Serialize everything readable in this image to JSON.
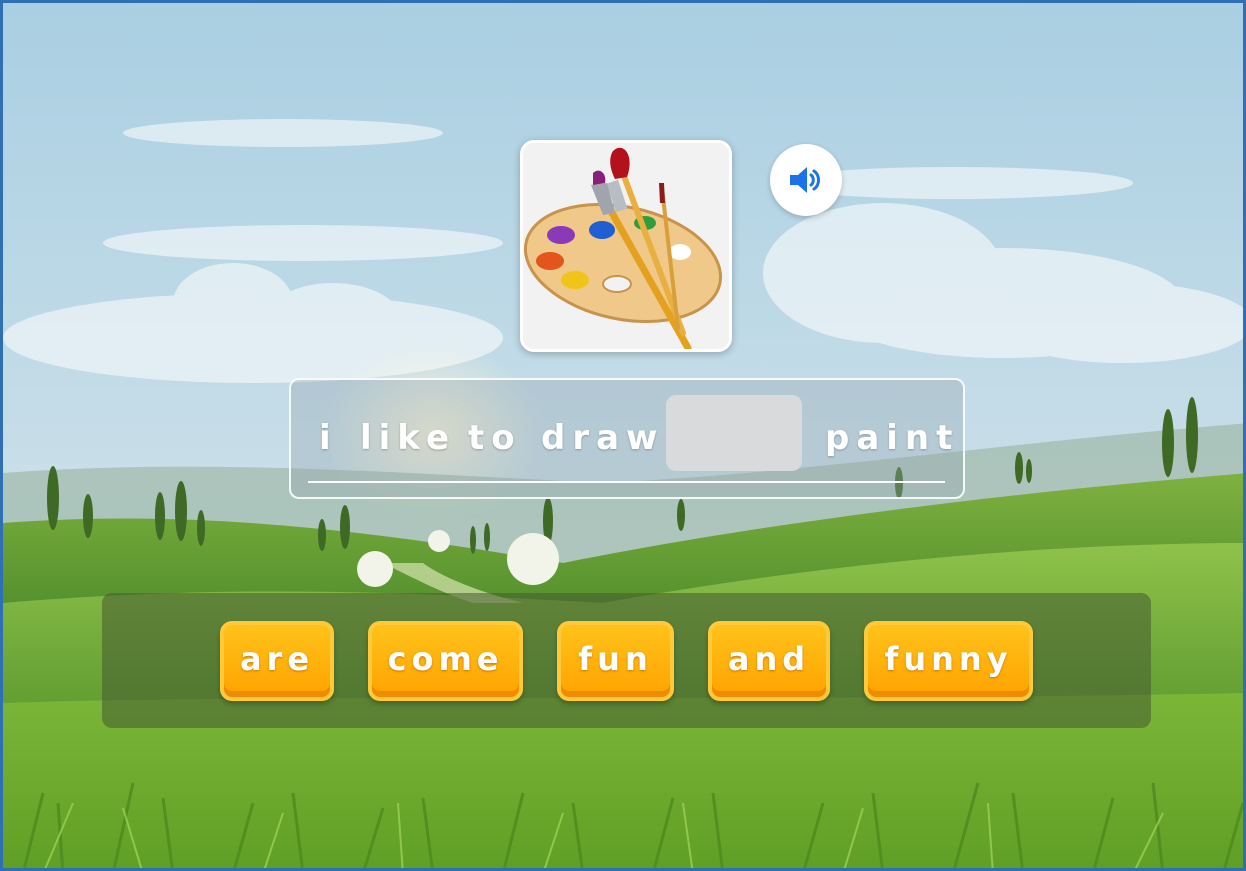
{
  "sentence": {
    "words_before": [
      "i",
      "like",
      "to",
      "draw"
    ],
    "words_after": [
      "paint"
    ]
  },
  "word_bank": [
    "are",
    "come",
    "fun",
    "and",
    "funny"
  ],
  "picture_icon": "paint-palette-brushes-icon",
  "sound_icon": "speaker-icon",
  "colors": {
    "tile": "#ffa300",
    "sound_icon": "#1a73e8",
    "frame": "#2f6fb3"
  }
}
